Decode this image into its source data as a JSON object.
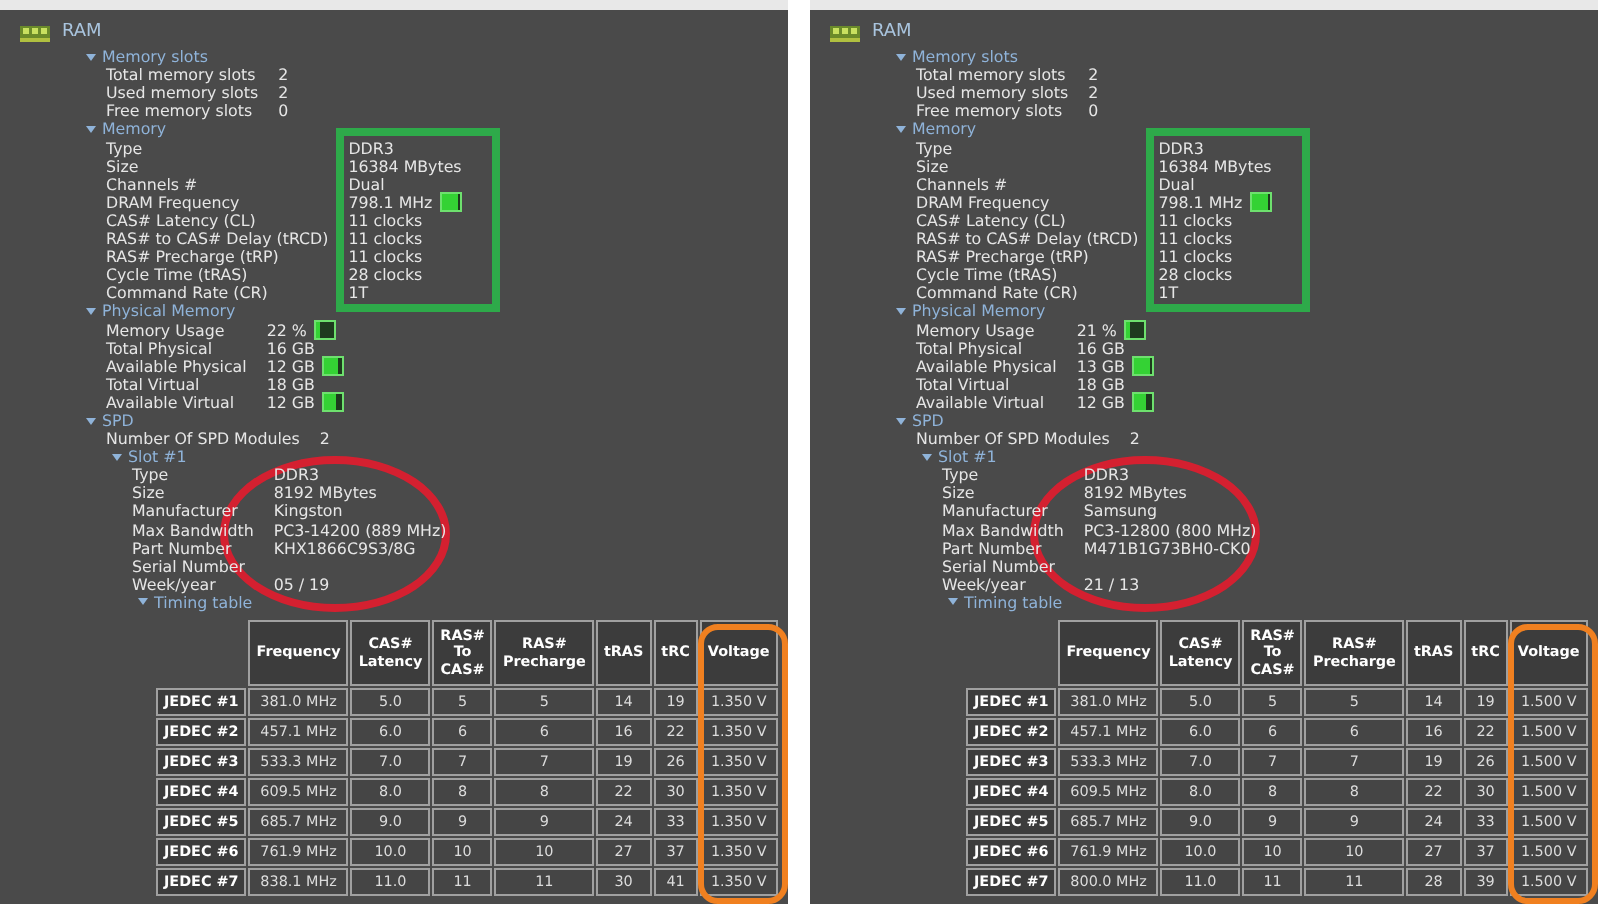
{
  "panels": [
    {
      "title": "RAM",
      "sections": [
        {
          "label": "Memory slots",
          "expanded": true,
          "rows": [
            {
              "label": "Total memory slots",
              "value": "2"
            },
            {
              "label": "Used memory slots",
              "value": "2"
            },
            {
              "label": "Free memory slots",
              "value": "0"
            }
          ]
        },
        {
          "label": "Memory",
          "expanded": true,
          "rows": [
            {
              "label": "Type",
              "value": "DDR3"
            },
            {
              "label": "Size",
              "value": "16384 MBytes"
            },
            {
              "label": "Channels #",
              "value": "Dual"
            },
            {
              "label": "DRAM Frequency",
              "value": "798.1 MHz",
              "level": 0.85
            },
            {
              "label": "CAS# Latency (CL)",
              "value": "11 clocks"
            },
            {
              "label": "RAS# to CAS# Delay (tRCD)",
              "value": "11 clocks"
            },
            {
              "label": "RAS# Precharge (tRP)",
              "value": "11 clocks"
            },
            {
              "label": "Cycle Time (tRAS)",
              "value": "28 clocks"
            },
            {
              "label": "Command Rate (CR)",
              "value": "1T"
            }
          ]
        },
        {
          "label": "Physical Memory",
          "expanded": true,
          "rows": [
            {
              "label": "Memory Usage",
              "value": "22 %",
              "level": 0.22
            },
            {
              "label": "Total Physical",
              "value": "16 GB"
            },
            {
              "label": "Available Physical",
              "value": "12 GB",
              "level": 0.75
            },
            {
              "label": "Total Virtual",
              "value": "18 GB"
            },
            {
              "label": "Available Virtual",
              "value": "12 GB",
              "level": 0.67
            }
          ]
        },
        {
          "label": "SPD",
          "expanded": true,
          "rows": [
            {
              "label": "Number Of SPD Modules",
              "value": "2"
            }
          ],
          "children": [
            {
              "label": "Slot #1",
              "expanded": true,
              "rows": [
                {
                  "label": "Type",
                  "value": "DDR3"
                },
                {
                  "label": "Size",
                  "value": "8192 MBytes"
                },
                {
                  "label": "Manufacturer",
                  "value": "Kingston"
                },
                {
                  "label": "Max Bandwidth",
                  "value": "PC3-14200 (889 MHz)"
                },
                {
                  "label": "Part Number",
                  "value": "KHX1866C9S3/8G"
                },
                {
                  "label": "Serial Number"
                },
                {
                  "label": "Week/year",
                  "value": "05 / 19"
                }
              ],
              "children": [
                {
                  "label": "Timing table",
                  "expanded": true,
                  "table": {
                    "columns": [
                      "Frequency",
                      "CAS#\nLatency",
                      "RAS#\nTo\nCAS#",
                      "RAS#\nPrecharge",
                      "tRAS",
                      "tRC",
                      "Voltage"
                    ],
                    "rows": [
                      {
                        "label": "JEDEC #1",
                        "cells": [
                          "381.0 MHz",
                          "5.0",
                          "5",
                          "5",
                          "14",
                          "19",
                          "1.350 V"
                        ]
                      },
                      {
                        "label": "JEDEC #2",
                        "cells": [
                          "457.1 MHz",
                          "6.0",
                          "6",
                          "6",
                          "16",
                          "22",
                          "1.350 V"
                        ]
                      },
                      {
                        "label": "JEDEC #3",
                        "cells": [
                          "533.3 MHz",
                          "7.0",
                          "7",
                          "7",
                          "19",
                          "26",
                          "1.350 V"
                        ]
                      },
                      {
                        "label": "JEDEC #4",
                        "cells": [
                          "609.5 MHz",
                          "8.0",
                          "8",
                          "8",
                          "22",
                          "30",
                          "1.350 V"
                        ]
                      },
                      {
                        "label": "JEDEC #5",
                        "cells": [
                          "685.7 MHz",
                          "9.0",
                          "9",
                          "9",
                          "24",
                          "33",
                          "1.350 V"
                        ]
                      },
                      {
                        "label": "JEDEC #6",
                        "cells": [
                          "761.9 MHz",
                          "10.0",
                          "10",
                          "10",
                          "27",
                          "37",
                          "1.350 V"
                        ]
                      },
                      {
                        "label": "JEDEC #7",
                        "cells": [
                          "838.1 MHz",
                          "11.0",
                          "11",
                          "11",
                          "30",
                          "41",
                          "1.350 V"
                        ]
                      }
                    ]
                  }
                }
              ]
            }
          ]
        }
      ],
      "highlights": [
        {
          "kind": "box",
          "color": "#2eaa4a"
        },
        {
          "kind": "ellipse",
          "color": "#d42030"
        },
        {
          "kind": "column",
          "color": "#f08020"
        }
      ]
    },
    {
      "title": "RAM",
      "sections": [
        {
          "label": "Memory slots",
          "expanded": true,
          "rows": [
            {
              "label": "Total memory slots",
              "value": "2"
            },
            {
              "label": "Used memory slots",
              "value": "2"
            },
            {
              "label": "Free memory slots",
              "value": "0"
            }
          ]
        },
        {
          "label": "Memory",
          "expanded": true,
          "rows": [
            {
              "label": "Type",
              "value": "DDR3"
            },
            {
              "label": "Size",
              "value": "16384 MBytes"
            },
            {
              "label": "Channels #",
              "value": "Dual"
            },
            {
              "label": "DRAM Frequency",
              "value": "798.1 MHz",
              "level": 0.85
            },
            {
              "label": "CAS# Latency (CL)",
              "value": "11 clocks"
            },
            {
              "label": "RAS# to CAS# Delay (tRCD)",
              "value": "11 clocks"
            },
            {
              "label": "RAS# Precharge (tRP)",
              "value": "11 clocks"
            },
            {
              "label": "Cycle Time (tRAS)",
              "value": "28 clocks"
            },
            {
              "label": "Command Rate (CR)",
              "value": "1T"
            }
          ]
        },
        {
          "label": "Physical Memory",
          "expanded": true,
          "rows": [
            {
              "label": "Memory Usage",
              "value": "21 %",
              "level": 0.21
            },
            {
              "label": "Total Physical",
              "value": "16 GB"
            },
            {
              "label": "Available Physical",
              "value": "13 GB",
              "level": 0.81
            },
            {
              "label": "Total Virtual",
              "value": "18 GB"
            },
            {
              "label": "Available Virtual",
              "value": "12 GB",
              "level": 0.67
            }
          ]
        },
        {
          "label": "SPD",
          "expanded": true,
          "rows": [
            {
              "label": "Number Of SPD Modules",
              "value": "2"
            }
          ],
          "children": [
            {
              "label": "Slot #1",
              "expanded": true,
              "rows": [
                {
                  "label": "Type",
                  "value": "DDR3"
                },
                {
                  "label": "Size",
                  "value": "8192 MBytes"
                },
                {
                  "label": "Manufacturer",
                  "value": "Samsung"
                },
                {
                  "label": "Max Bandwidth",
                  "value": "PC3-12800 (800 MHz)"
                },
                {
                  "label": "Part Number",
                  "value": "M471B1G73BH0-CK0"
                },
                {
                  "label": "Serial Number"
                },
                {
                  "label": "Week/year",
                  "value": "21 / 13"
                }
              ],
              "children": [
                {
                  "label": "Timing table",
                  "expanded": true,
                  "table": {
                    "columns": [
                      "Frequency",
                      "CAS#\nLatency",
                      "RAS#\nTo\nCAS#",
                      "RAS#\nPrecharge",
                      "tRAS",
                      "tRC",
                      "Voltage"
                    ],
                    "rows": [
                      {
                        "label": "JEDEC #1",
                        "cells": [
                          "381.0 MHz",
                          "5.0",
                          "5",
                          "5",
                          "14",
                          "19",
                          "1.500 V"
                        ]
                      },
                      {
                        "label": "JEDEC #2",
                        "cells": [
                          "457.1 MHz",
                          "6.0",
                          "6",
                          "6",
                          "16",
                          "22",
                          "1.500 V"
                        ]
                      },
                      {
                        "label": "JEDEC #3",
                        "cells": [
                          "533.3 MHz",
                          "7.0",
                          "7",
                          "7",
                          "19",
                          "26",
                          "1.500 V"
                        ]
                      },
                      {
                        "label": "JEDEC #4",
                        "cells": [
                          "609.5 MHz",
                          "8.0",
                          "8",
                          "8",
                          "22",
                          "30",
                          "1.500 V"
                        ]
                      },
                      {
                        "label": "JEDEC #5",
                        "cells": [
                          "685.7 MHz",
                          "9.0",
                          "9",
                          "9",
                          "24",
                          "33",
                          "1.500 V"
                        ]
                      },
                      {
                        "label": "JEDEC #6",
                        "cells": [
                          "761.9 MHz",
                          "10.0",
                          "10",
                          "10",
                          "27",
                          "37",
                          "1.500 V"
                        ]
                      },
                      {
                        "label": "JEDEC #7",
                        "cells": [
                          "800.0 MHz",
                          "11.0",
                          "11",
                          "11",
                          "28",
                          "39",
                          "1.500 V"
                        ]
                      }
                    ]
                  }
                }
              ]
            }
          ]
        }
      ],
      "highlights": [
        {
          "kind": "box",
          "color": "#2eaa4a"
        },
        {
          "kind": "ellipse",
          "color": "#d42030"
        },
        {
          "kind": "column",
          "color": "#f08020"
        }
      ]
    }
  ]
}
